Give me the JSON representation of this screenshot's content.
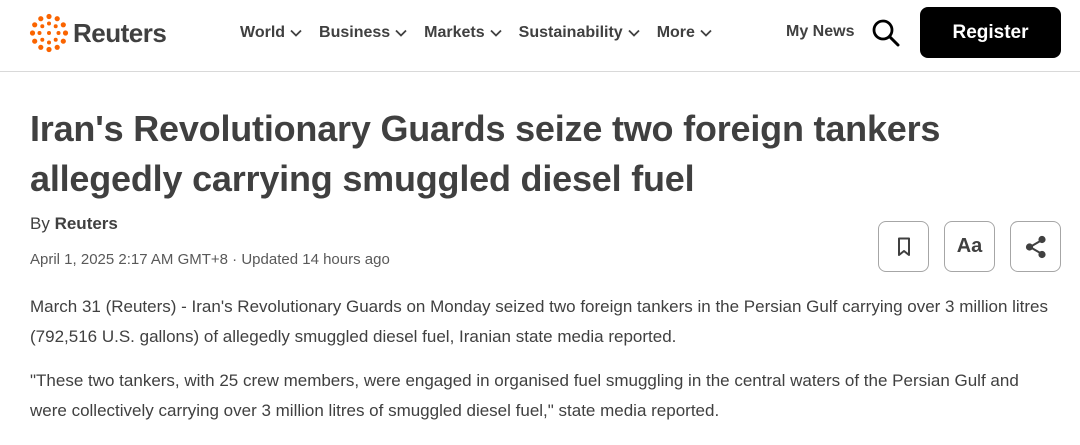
{
  "header": {
    "logo_text": "Reuters",
    "nav": [
      {
        "label": "World"
      },
      {
        "label": "Business"
      },
      {
        "label": "Markets"
      },
      {
        "label": "Sustainability"
      },
      {
        "label": "More"
      }
    ],
    "my_news_label": "My News",
    "register_label": "Register",
    "brand_color": "#fa6400"
  },
  "article": {
    "headline": "Iran's Revolutionary Guards seize two foreign tankers allegedly carrying smuggled diesel fuel",
    "byline_prefix": "By",
    "byline_author": "Reuters",
    "dateline": "April 1, 2025 2:17 AM GMT+8 · Updated 14 hours ago",
    "text_size_label": "Aa",
    "paragraphs": [
      "March 31 (Reuters) - Iran's Revolutionary Guards on Monday seized two foreign tankers in the Persian Gulf carrying over 3 million litres (792,516 U.S. gallons) of allegedly smuggled diesel fuel, Iranian state media reported.",
      "\"These two tankers, with 25 crew members, were engaged in organised fuel smuggling in the central waters of the Persian Gulf and were collectively carrying over 3 million litres of smuggled diesel fuel,\" state media reported."
    ]
  },
  "icons": {
    "logo": "reuters-dots-logo-icon",
    "nav_chevron": "chevron-down-icon",
    "search": "search-icon",
    "bookmark": "bookmark-icon",
    "share": "share-icon"
  }
}
